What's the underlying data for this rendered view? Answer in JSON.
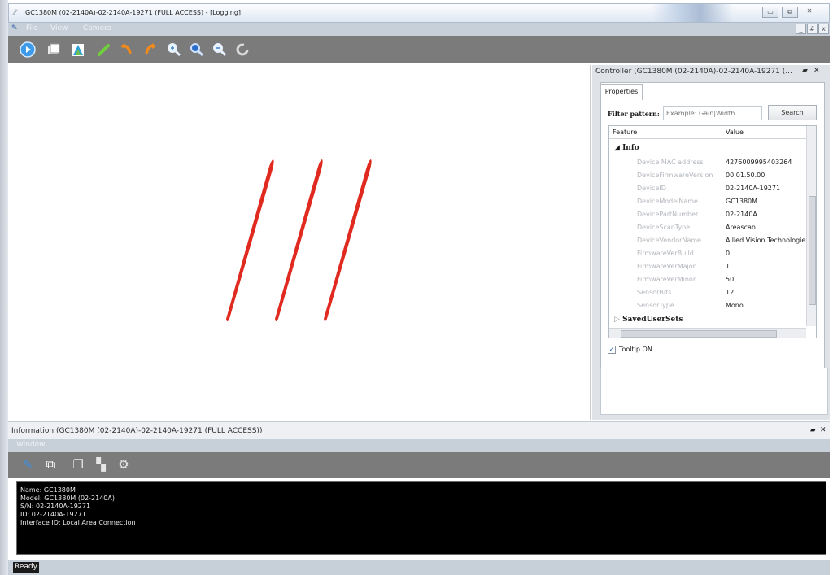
{
  "window": {
    "title": "GC1380M (02-2140A)-02-2140A-19271 (FULL ACCESS) - [Logging]",
    "app_icon": "app-icon",
    "controls": [
      "minimize-icon",
      "restore-icon",
      "close-icon"
    ]
  },
  "menu": {
    "items": [
      "File",
      "View",
      "Camera"
    ],
    "mdi_controls": [
      "_",
      "#",
      "x"
    ]
  },
  "toolbar": {
    "icons": [
      "play-icon",
      "snapshot-icon",
      "histogram-icon",
      "pencil-green-icon",
      "rotate-left-icon",
      "rotate-right-icon",
      "zoom-in-icon",
      "zoom-fit-icon",
      "zoom-out-icon",
      "refresh-icon"
    ]
  },
  "controller": {
    "title": "Controller  (GC1380M (02-2140A)-02-2140A-19271 (...",
    "pin_icon": "pin-icon",
    "close_icon": "close-icon",
    "tab": "Properties",
    "filter_label": "Filter pattern:",
    "filter_placeholder": "Example: Gain|Width",
    "search_label": "Search",
    "columns": [
      "Feature",
      "Value"
    ],
    "categories": [
      "Info",
      "SavedUserSets"
    ],
    "properties": [
      {
        "feature": "Device MAC address",
        "value": "4276009995403264"
      },
      {
        "feature": "DeviceFirmwareVersion",
        "value": "00.01.50.00"
      },
      {
        "feature": "DeviceID",
        "value": "02-2140A-19271"
      },
      {
        "feature": "DeviceModelName",
        "value": "GC1380M"
      },
      {
        "feature": "DevicePartNumber",
        "value": "02-2140A"
      },
      {
        "feature": "DeviceScanType",
        "value": "Areascan"
      },
      {
        "feature": "DeviceVendorName",
        "value": "Allied Vision Technologies"
      },
      {
        "feature": "FirmwareVerBuild",
        "value": "0"
      },
      {
        "feature": "FirmwareVerMajor",
        "value": "1"
      },
      {
        "feature": "FirmwareVerMinor",
        "value": "50"
      },
      {
        "feature": "SensorBits",
        "value": "12"
      },
      {
        "feature": "SensorType",
        "value": "Mono"
      }
    ],
    "tooltip_label": "Tooltip ON",
    "tooltip_checked": true
  },
  "information": {
    "title": "Information (GC1380M (02-2140A)-02-2140A-19271 (FULL ACCESS))",
    "window_menu": "Window",
    "toolbar_icons": [
      "pencil-icon",
      "open-window-icon",
      "copy-icon",
      "tile-icon",
      "gear-icon"
    ],
    "log_lines": [
      "Name: GC1380M",
      "Model: GC1380M (02-2140A)",
      "S/N: 02-2140A-19271",
      "ID: 02-2140A-19271",
      "Interface ID: Local Area Connection"
    ]
  },
  "status": {
    "text": "Ready"
  },
  "colors": {
    "toolbar": "#7b7b7b",
    "menu": "#c7cfd9",
    "stroke": "#e02a1f",
    "console_bg": "#000000"
  }
}
